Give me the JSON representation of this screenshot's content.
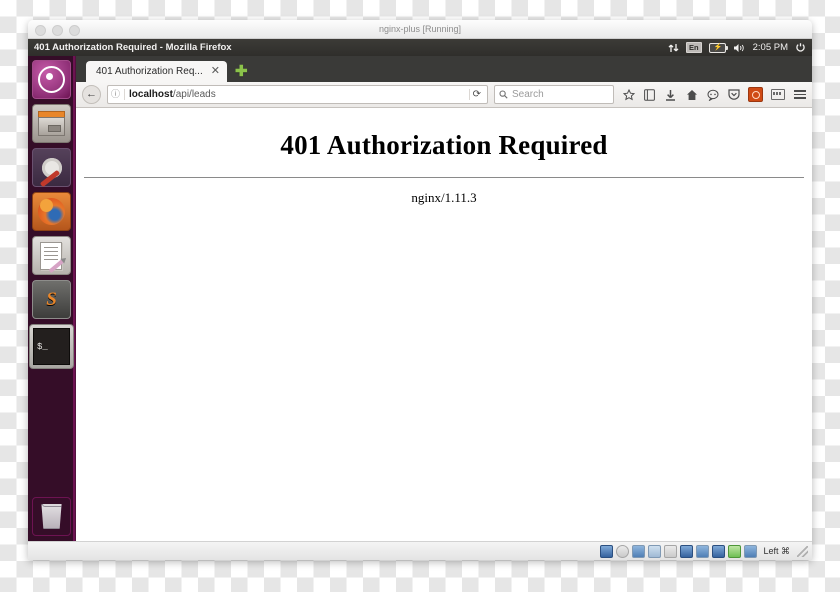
{
  "vbox": {
    "vm_title": "nginx-plus [Running]",
    "traffic_lights": [
      "close-button",
      "minimize-button",
      "zoom-button"
    ],
    "status": {
      "devices": [
        "hard-disk-icon",
        "optical-disk-icon",
        "floppy-icon",
        "audio-icon",
        "network-icon",
        "display-icon",
        "shared-folder-icon",
        "usb-icon",
        "webcam-icon",
        "capture-icon"
      ],
      "host_key_label": "Left ⌘"
    }
  },
  "ubuntu": {
    "topbar": {
      "window_title": "401 Authorization Required - Mozilla Firefox",
      "tray": {
        "network_icon": "network-up-down-icon",
        "keyboard_layout": "En",
        "battery_icon": "battery-charging-icon",
        "volume_icon": "volume-icon",
        "clock": "2:05 PM",
        "session_icon": "power-gear-icon"
      }
    },
    "launcher": {
      "items": [
        {
          "name": "ubuntu-dash",
          "label": "Dash home"
        },
        {
          "name": "files",
          "label": "Files"
        },
        {
          "name": "system-settings",
          "label": "System Settings"
        },
        {
          "name": "firefox",
          "label": "Firefox Web Browser"
        },
        {
          "name": "text-editor",
          "label": "Text Editor"
        },
        {
          "name": "sublime-text",
          "label": "Sublime Text",
          "glyph": "S"
        },
        {
          "name": "terminal",
          "label": "Terminal",
          "glyph": "$_"
        }
      ],
      "trash": {
        "name": "trash",
        "label": "Trash"
      }
    }
  },
  "firefox": {
    "tab": {
      "title": "401 Authorization Req...",
      "close_label": "✕"
    },
    "new_tab_label": "✚",
    "nav": {
      "back_label": "←",
      "identity_icon": "info-circle-icon",
      "url_host": "localhost",
      "url_path": "/api/leads",
      "reload_label": "⟳",
      "search_placeholder": "Search",
      "search_icon": "search-icon"
    },
    "toolbar_icons": [
      "bookmark-star-icon",
      "library-icon",
      "downloads-icon",
      "home-icon",
      "chat-icon",
      "pocket-icon",
      "extension-orange-icon",
      "cards-icon",
      "hamburger-menu-icon"
    ]
  },
  "page": {
    "heading": "401 Authorization Required",
    "server_signature": "nginx/1.11.3"
  },
  "colors": {
    "ubuntu_aubergine": "#2c001e",
    "launcher_purple": "#350d28",
    "topbar_dark": "#3c3b37",
    "firefox_orange": "#e8862a",
    "accent_green": "#8bc34a"
  }
}
